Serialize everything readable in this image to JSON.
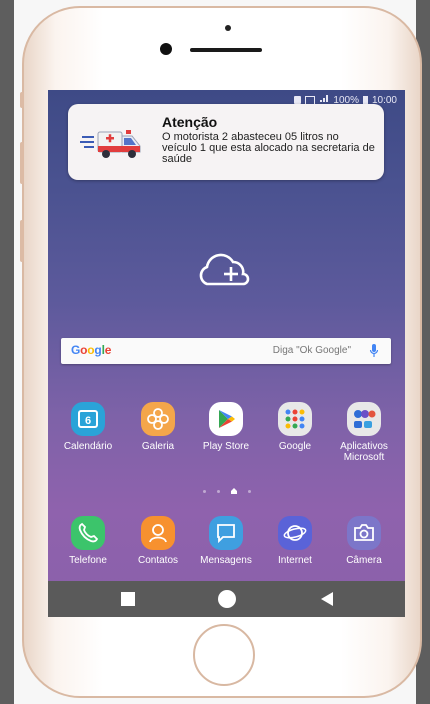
{
  "status_bar": {
    "battery_text": "100%",
    "time": "10:00"
  },
  "notification": {
    "title": "Atenção",
    "body": "O motorista 2 abasteceu 05 litros no veículo 1 que esta alocado na secretaria de saúde"
  },
  "search": {
    "logo": "Google",
    "hint": "Diga \"Ok Google\""
  },
  "calendar_day": "6",
  "apps_row1": [
    {
      "label": "Calendário",
      "icon": "calendar-icon",
      "color": "#2aa3d8"
    },
    {
      "label": "Galeria",
      "icon": "gallery-flower-icon",
      "color": "#f4a64a"
    },
    {
      "label": "Play Store",
      "icon": "play-store-icon",
      "color": "#ffffff"
    },
    {
      "label": "Google",
      "icon": "google-folder-icon",
      "color": "#e8e8e8"
    },
    {
      "label": "Aplicativos Microsoft",
      "icon": "microsoft-folder-icon",
      "color": "#e8e8e8"
    }
  ],
  "apps_row2": [
    {
      "label": "Telefone",
      "icon": "phone-icon",
      "color": "#3cc46b"
    },
    {
      "label": "Contatos",
      "icon": "contacts-icon",
      "color": "#f7912f"
    },
    {
      "label": "Mensagens",
      "icon": "messages-icon",
      "color": "#3f9fe0"
    },
    {
      "label": "Internet",
      "icon": "internet-icon",
      "color": "#5a63d8"
    },
    {
      "label": "Câmera",
      "icon": "camera-icon",
      "color": "#7c76c9"
    }
  ],
  "navbar": {
    "recent": "recent-apps-icon",
    "home": "home-icon",
    "back": "back-icon"
  }
}
